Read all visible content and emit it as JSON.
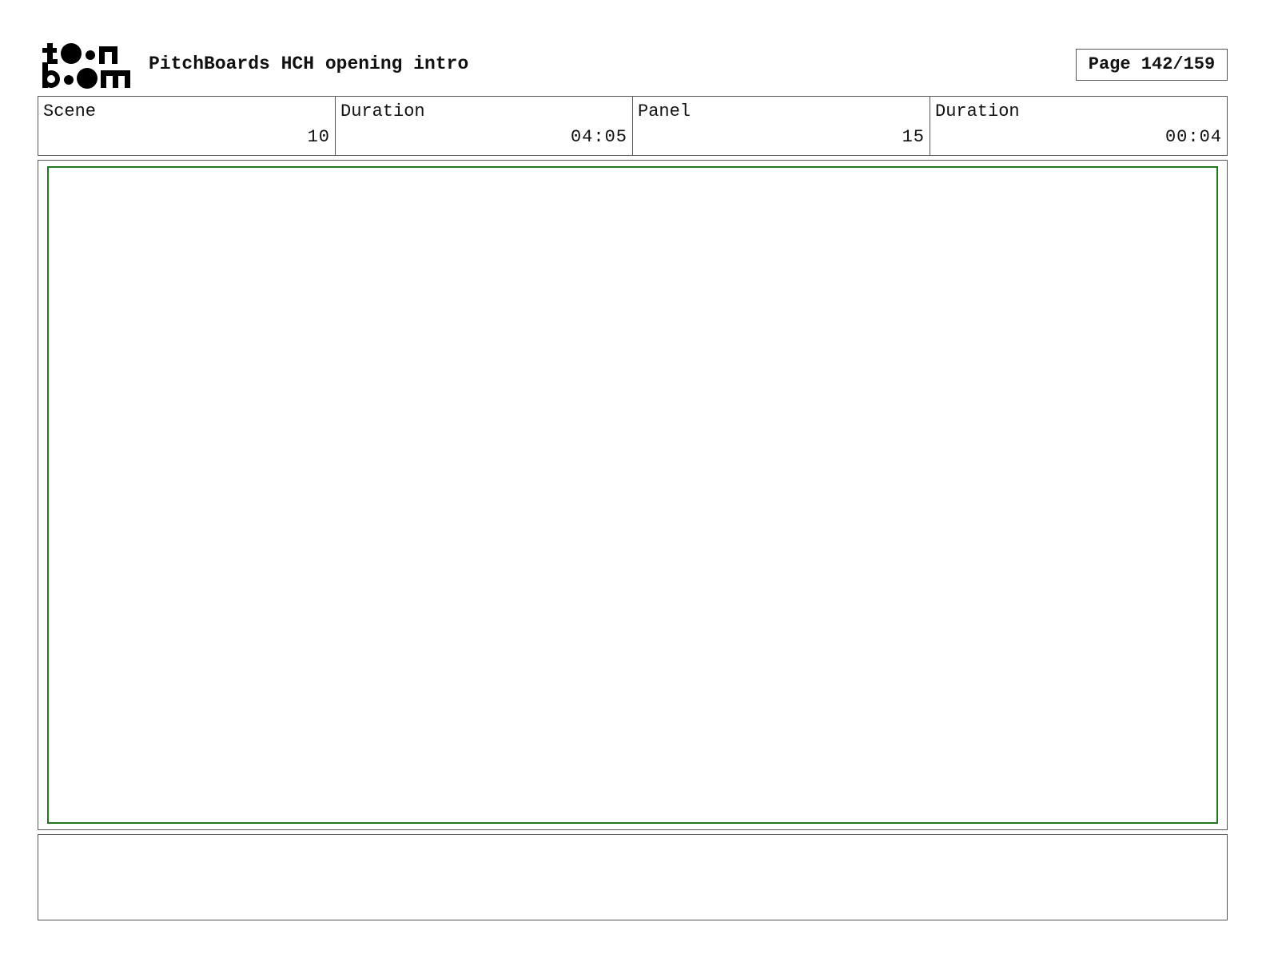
{
  "header": {
    "logo_text": "toon boom",
    "title": "PitchBoards HCH opening intro",
    "page_label": "Page 142/159"
  },
  "info": [
    {
      "label": "Scene",
      "value": "10"
    },
    {
      "label": "Duration",
      "value": "04:05"
    },
    {
      "label": "Panel",
      "value": "15"
    },
    {
      "label": "Duration",
      "value": "00:04"
    }
  ],
  "panel": {
    "border_color": "#1f7a1f"
  }
}
